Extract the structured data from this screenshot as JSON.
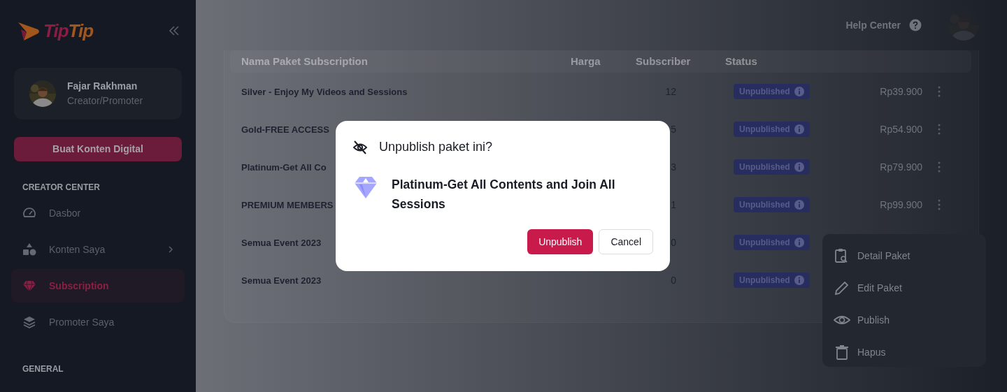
{
  "sidebar": {
    "logo": {
      "part_1": "Tip",
      "part_2": "Tip"
    },
    "profile": {
      "name": "Fajar Rakhman",
      "role": "Creator/Promoter"
    },
    "create_button": "Buat Konten Digital",
    "sections": [
      {
        "title": "CREATOR CENTER",
        "items": [
          {
            "label": "Dasbor",
            "selected": false,
            "has_submenu": false
          },
          {
            "label": "Konten Saya",
            "selected": false,
            "has_submenu": true
          },
          {
            "label": "Subscription",
            "selected": true,
            "has_submenu": false
          },
          {
            "label": "Promoter Saya",
            "selected": false,
            "has_submenu": false
          }
        ]
      },
      {
        "title": "GENERAL"
      }
    ]
  },
  "topbar": {
    "help": "Help Center"
  },
  "table": {
    "columns": [
      "Nama Paket Subscription",
      "Harga",
      "Subscriber",
      "Status"
    ],
    "rows": [
      {
        "name": "Silver - Enjoy My Videos and Sessions",
        "subscribers": "12",
        "status": "Unpublished",
        "price": "Rp39.900",
        "has_menu": true
      },
      {
        "name": "Gold-FREE ACCESS",
        "subscribers": "5",
        "status": "Unpublished",
        "price": "Rp54.900",
        "has_menu": true
      },
      {
        "name": "Platinum-Get All Co",
        "subscribers": "3",
        "status": "Unpublished",
        "price": "Rp79.900",
        "has_menu": true
      },
      {
        "name": "PREMIUM MEMBERS",
        "subscribers": "1",
        "status": "Unpublished",
        "price": "Rp99.900",
        "has_menu": true
      },
      {
        "name": "Semua Event 2023",
        "subscribers": "0",
        "status": "Unpublished",
        "has_menu": false
      },
      {
        "name": "Semua Event 2023",
        "subscribers": "0",
        "status": "Unpublished",
        "has_menu": false
      }
    ]
  },
  "context_menu": {
    "items": [
      "Detail Paket",
      "Edit Paket",
      "Publish",
      "Hapus"
    ]
  },
  "dialog": {
    "title": "Unpublish paket ini?",
    "package_name": "Platinum-Get All Contents and Join All Sessions",
    "buttons": [
      {
        "label": "Unpublish",
        "kind": "primary"
      },
      {
        "label": "Cancel",
        "kind": "secondary"
      }
    ]
  }
}
